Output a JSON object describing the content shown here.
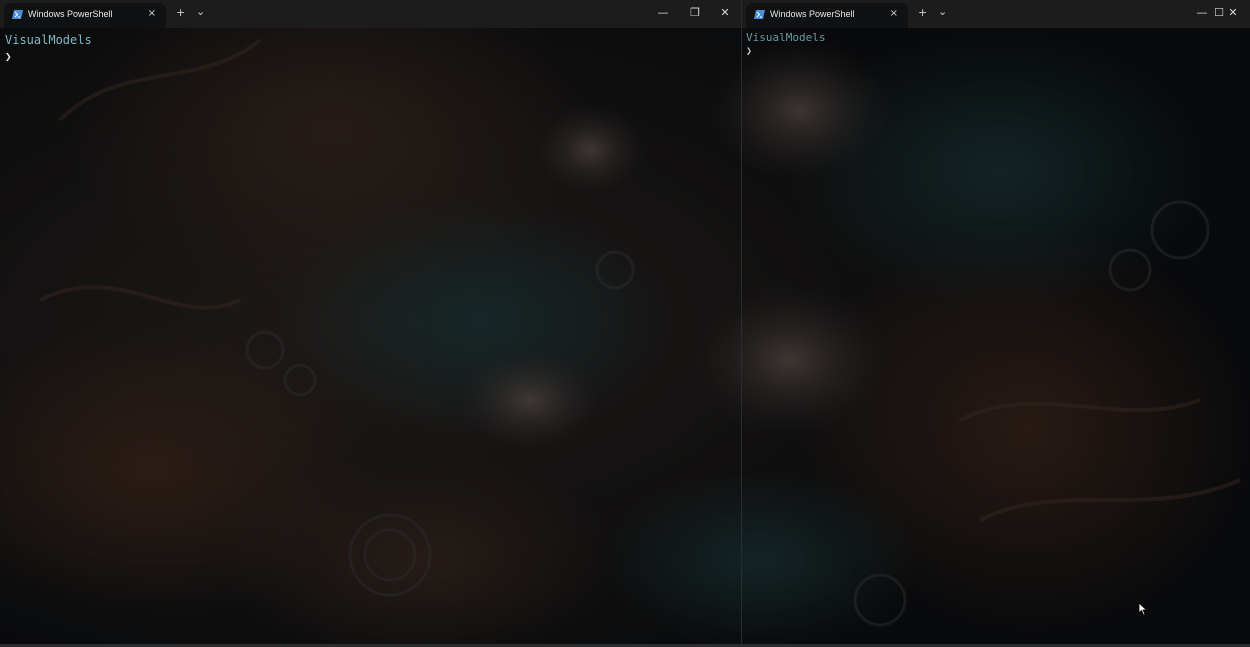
{
  "colors": {
    "titlebar": "#1c1c1c",
    "tab_active": "#0f1113",
    "prompt_dir": "#7fb6c2",
    "prompt_caret": "#e6e6e6",
    "background_art": "dark underwater fish artwork"
  },
  "left_window": {
    "tab": {
      "icon": "powershell-icon",
      "title": "Windows PowerShell",
      "close_icon": "×"
    },
    "new_tab_icon": "+",
    "dropdown_icon": "⌄",
    "controls": {
      "minimize": "—",
      "restore": "❐",
      "close": "✕"
    },
    "terminal": {
      "directory": "VisualModels",
      "prompt": "❯"
    }
  },
  "right_window": {
    "tab": {
      "icon": "powershell-icon",
      "title": "Windows PowerShell",
      "close_icon": "×"
    },
    "new_tab_icon": "+",
    "dropdown_icon": "⌄",
    "controls": {
      "minimize": "—",
      "maximize": "☐",
      "close": "✕"
    },
    "terminal": {
      "directory": "VisualModels",
      "prompt": "❯"
    }
  },
  "pointer": {
    "icon": "mouse-cursor-icon"
  }
}
